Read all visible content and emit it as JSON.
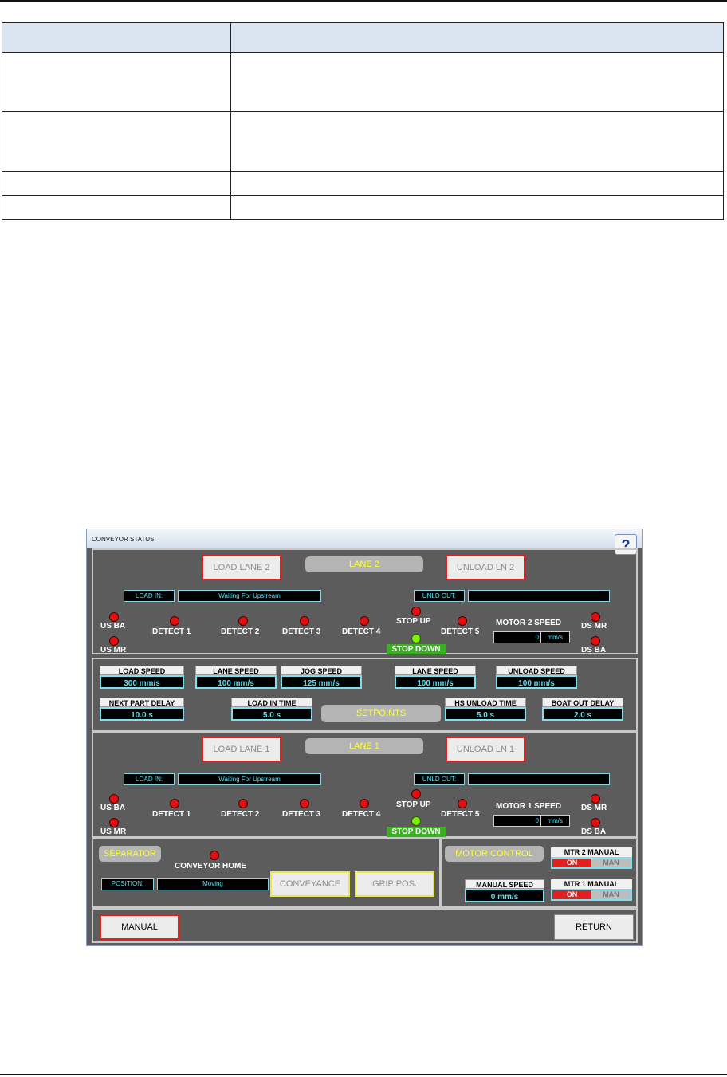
{
  "doc_table": {
    "rows": 5
  },
  "window": {
    "title": "CONVEYOR STATUS",
    "help_label": "?",
    "lane2": {
      "load_btn": "LOAD LANE 2",
      "label": "LANE 2",
      "unload_btn": "UNLOAD LN 2",
      "load_in_label": "LOAD IN:",
      "load_in_value": "Waiting For Upstream",
      "unld_out_label": "UNLD OUT:",
      "unld_out_value": "",
      "sensors": {
        "us_ba": "US BA",
        "us_mr": "US MR",
        "detect1": "DETECT 1",
        "detect2": "DETECT 2",
        "detect3": "DETECT 3",
        "detect4": "DETECT 4",
        "stop_up": "STOP UP",
        "stop_down": "STOP DOWN",
        "detect5": "DETECT 5",
        "ds_mr": "DS MR",
        "ds_ba": "DS BA"
      },
      "motor_label": "MOTOR 2 SPEED",
      "motor_value": "0",
      "motor_unit": "mm/s"
    },
    "setpoints": {
      "label": "SETPOINTS",
      "load_speed": {
        "label": "LOAD SPEED",
        "value": "300  mm/s"
      },
      "lane_speed_a": {
        "label": "LANE SPEED",
        "value": "100  mm/s"
      },
      "jog_speed": {
        "label": "JOG SPEED",
        "value": "125  mm/s"
      },
      "lane_speed_b": {
        "label": "LANE SPEED",
        "value": "100  mm/s"
      },
      "unload_speed": {
        "label": "UNLOAD SPEED",
        "value": "100  mm/s"
      },
      "next_part_delay": {
        "label": "NEXT PART DELAY",
        "value": "10.0  s"
      },
      "load_in_time": {
        "label": "LOAD IN TIME",
        "value": "5.0  s"
      },
      "hs_unload_time": {
        "label": "HS UNLOAD TIME",
        "value": "5.0  s"
      },
      "boat_out_delay": {
        "label": "BOAT OUT DELAY",
        "value": "2.0  s"
      }
    },
    "lane1": {
      "load_btn": "LOAD LANE 1",
      "label": "LANE 1",
      "unload_btn": "UNLOAD LN 1",
      "load_in_label": "LOAD IN:",
      "load_in_value": "Waiting For Upstream",
      "unld_out_label": "UNLD OUT:",
      "unld_out_value": "",
      "sensors": {
        "us_ba": "US BA",
        "us_mr": "US MR",
        "detect1": "DETECT 1",
        "detect2": "DETECT 2",
        "detect3": "DETECT 3",
        "detect4": "DETECT 4",
        "stop_up": "STOP UP",
        "stop_down": "STOP DOWN",
        "detect5": "DETECT 5",
        "ds_mr": "DS MR",
        "ds_ba": "DS BA"
      },
      "motor_label": "MOTOR 1 SPEED",
      "motor_value": "0",
      "motor_unit": "mm/s"
    },
    "separator": {
      "label": "SEPARATOR",
      "conveyor_home": "CONVEYOR HOME",
      "position_label": "POSITION:",
      "position_value": "Moving",
      "conveyance_btn": "CONVEYANCE",
      "grip_btn": "GRIP POS."
    },
    "motor_control": {
      "label": "MOTOR CONTROL",
      "mtr2": {
        "label": "MTR 2 MANUAL",
        "on": "ON",
        "man": "MAN"
      },
      "mtr1": {
        "label": "MTR 1 MANUAL",
        "on": "ON",
        "man": "MAN"
      },
      "manual_speed": {
        "label": "MANUAL SPEED",
        "value": "0  mm/s"
      }
    },
    "footer": {
      "manual_btn": "MANUAL",
      "return_btn": "RETURN"
    }
  }
}
